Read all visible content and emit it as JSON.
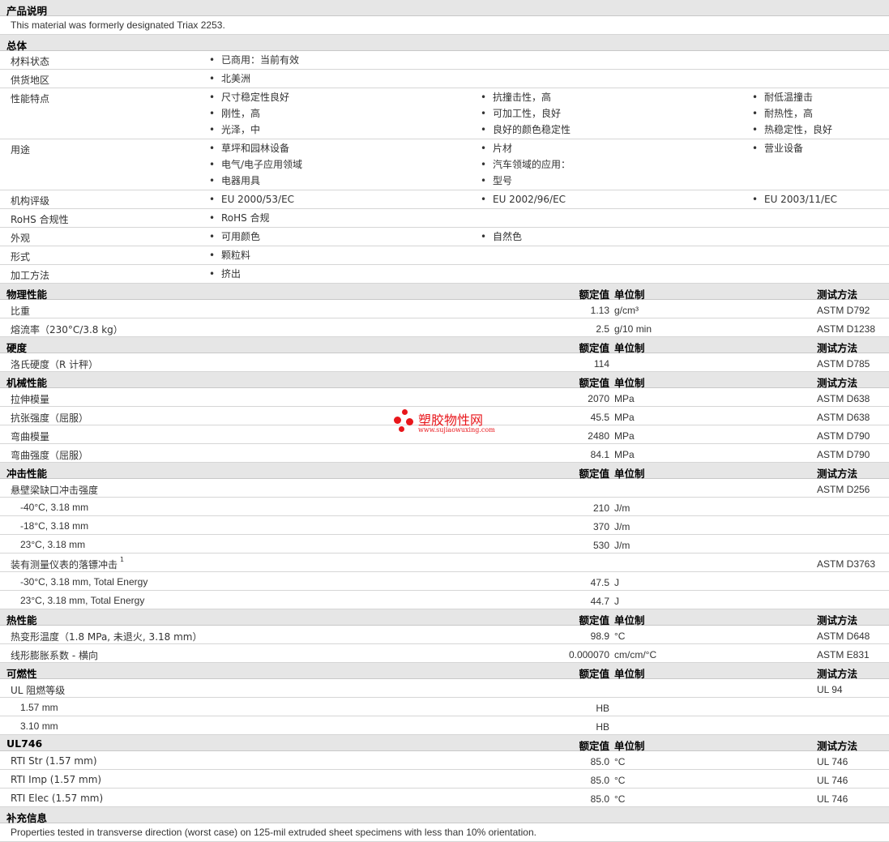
{
  "product_description": {
    "title": "产品说明",
    "text": "This material was formerly designated Triax 2253."
  },
  "general": {
    "title": "总体",
    "rows": [
      {
        "label": "材料状态",
        "col1": [
          "已商用：当前有效"
        ],
        "col2": [],
        "col3": []
      },
      {
        "label": "供货地区",
        "col1": [
          "北美洲"
        ],
        "col2": [],
        "col3": []
      },
      {
        "label": "性能特点",
        "col1": [
          "尺寸稳定性良好",
          "刚性，高",
          "光泽，中"
        ],
        "col2": [
          "抗撞击性，高",
          "可加工性，良好",
          "良好的颜色稳定性"
        ],
        "col3": [
          "耐低温撞击",
          "耐热性，高",
          "热稳定性，良好"
        ]
      },
      {
        "label": "用途",
        "col1": [
          "草坪和园林设备",
          "电气/电子应用领域",
          "电器用具"
        ],
        "col2": [
          "片材",
          "汽车领域的应用：",
          "型号"
        ],
        "col3": [
          "营业设备"
        ]
      },
      {
        "label": "机构评级",
        "col1": [
          "EU 2000/53/EC"
        ],
        "col2": [
          "EU 2002/96/EC"
        ],
        "col3": [
          "EU 2003/11/EC"
        ]
      },
      {
        "label": "RoHS 合规性",
        "col1": [
          "RoHS 合规"
        ],
        "col2": [],
        "col3": []
      },
      {
        "label": "外观",
        "col1": [
          "可用颜色"
        ],
        "col2": [
          "自然色"
        ],
        "col3": []
      },
      {
        "label": "形式",
        "col1": [
          "颗粒料"
        ],
        "col2": [],
        "col3": []
      },
      {
        "label": "加工方法",
        "col1": [
          "挤出"
        ],
        "col2": [],
        "col3": []
      }
    ]
  },
  "headers": {
    "value": "额定值",
    "unit": "单位制",
    "method": "测试方法"
  },
  "sections": [
    {
      "title": "物理性能",
      "rows": [
        {
          "label": "比重",
          "value": "1.13",
          "unit": "g/cm³",
          "method": "ASTM D792"
        },
        {
          "label": "熔流率（230°C/3.8 kg）",
          "value": "2.5",
          "unit": "g/10 min",
          "method": "ASTM D1238"
        }
      ]
    },
    {
      "title": "硬度",
      "rows": [
        {
          "label": "洛氏硬度（R 计秤）",
          "value": "114",
          "unit": "",
          "method": "ASTM D785"
        }
      ]
    },
    {
      "title": "机械性能",
      "rows": [
        {
          "label": "拉伸模量",
          "value": "2070",
          "unit": "MPa",
          "method": "ASTM D638"
        },
        {
          "label": "抗张强度（屈服）",
          "value": "45.5",
          "unit": "MPa",
          "method": "ASTM D638"
        },
        {
          "label": "弯曲模量",
          "value": "2480",
          "unit": "MPa",
          "method": "ASTM D790"
        },
        {
          "label": "弯曲强度（屈服）",
          "value": "84.1",
          "unit": "MPa",
          "method": "ASTM D790"
        }
      ]
    },
    {
      "title": "冲击性能",
      "rows": [
        {
          "label": "悬壁梁缺口冲击强度",
          "value": "",
          "unit": "",
          "method": "ASTM D256"
        },
        {
          "label": "-40°C, 3.18 mm",
          "value": "210",
          "unit": "J/m",
          "method": "",
          "sub": true
        },
        {
          "label": "-18°C, 3.18 mm",
          "value": "370",
          "unit": "J/m",
          "method": "",
          "sub": true
        },
        {
          "label": "23°C, 3.18 mm",
          "value": "530",
          "unit": "J/m",
          "method": "",
          "sub": true
        },
        {
          "label": "装有测量仪表的落镖冲击",
          "note": "1",
          "value": "",
          "unit": "",
          "method": "ASTM D3763"
        },
        {
          "label": "-30°C, 3.18 mm, Total Energy",
          "value": "47.5",
          "unit": "J",
          "method": "",
          "sub": true
        },
        {
          "label": "23°C, 3.18 mm, Total Energy",
          "value": "44.7",
          "unit": "J",
          "method": "",
          "sub": true
        }
      ]
    },
    {
      "title": "热性能",
      "rows": [
        {
          "label": "热变形温度（1.8 MPa, 未退火, 3.18 mm）",
          "value": "98.9",
          "unit": "°C",
          "method": "ASTM D648"
        },
        {
          "label": "线形膨胀系数 - 横向",
          "value": "0.000070",
          "unit": "cm/cm/°C",
          "method": "ASTM E831"
        }
      ]
    },
    {
      "title": "可燃性",
      "rows": [
        {
          "label": "UL 阻燃等级",
          "value": "",
          "unit": "",
          "method": "UL 94"
        },
        {
          "label": "1.57 mm",
          "value": "HB",
          "unit": "",
          "method": "",
          "sub": true
        },
        {
          "label": "3.10 mm",
          "value": "HB",
          "unit": "",
          "method": "",
          "sub": true
        }
      ]
    },
    {
      "title": "UL746",
      "rows": [
        {
          "label": "RTI Str (1.57 mm)",
          "value": "85.0",
          "unit": "°C",
          "method": "UL 746"
        },
        {
          "label": "RTI Imp (1.57 mm)",
          "value": "85.0",
          "unit": "°C",
          "method": "UL 746"
        },
        {
          "label": "RTI Elec (1.57 mm)",
          "value": "85.0",
          "unit": "°C",
          "method": "UL 746"
        }
      ]
    }
  ],
  "supplementary": {
    "title": "补充信息",
    "text": "Properties tested in transverse direction (worst case) on 125-mil extruded sheet specimens with less than 10% orientation."
  },
  "watermark": {
    "name": "塑胶物性网",
    "url": "www.sujiaowuxing.com",
    "color": "#e8161b"
  }
}
